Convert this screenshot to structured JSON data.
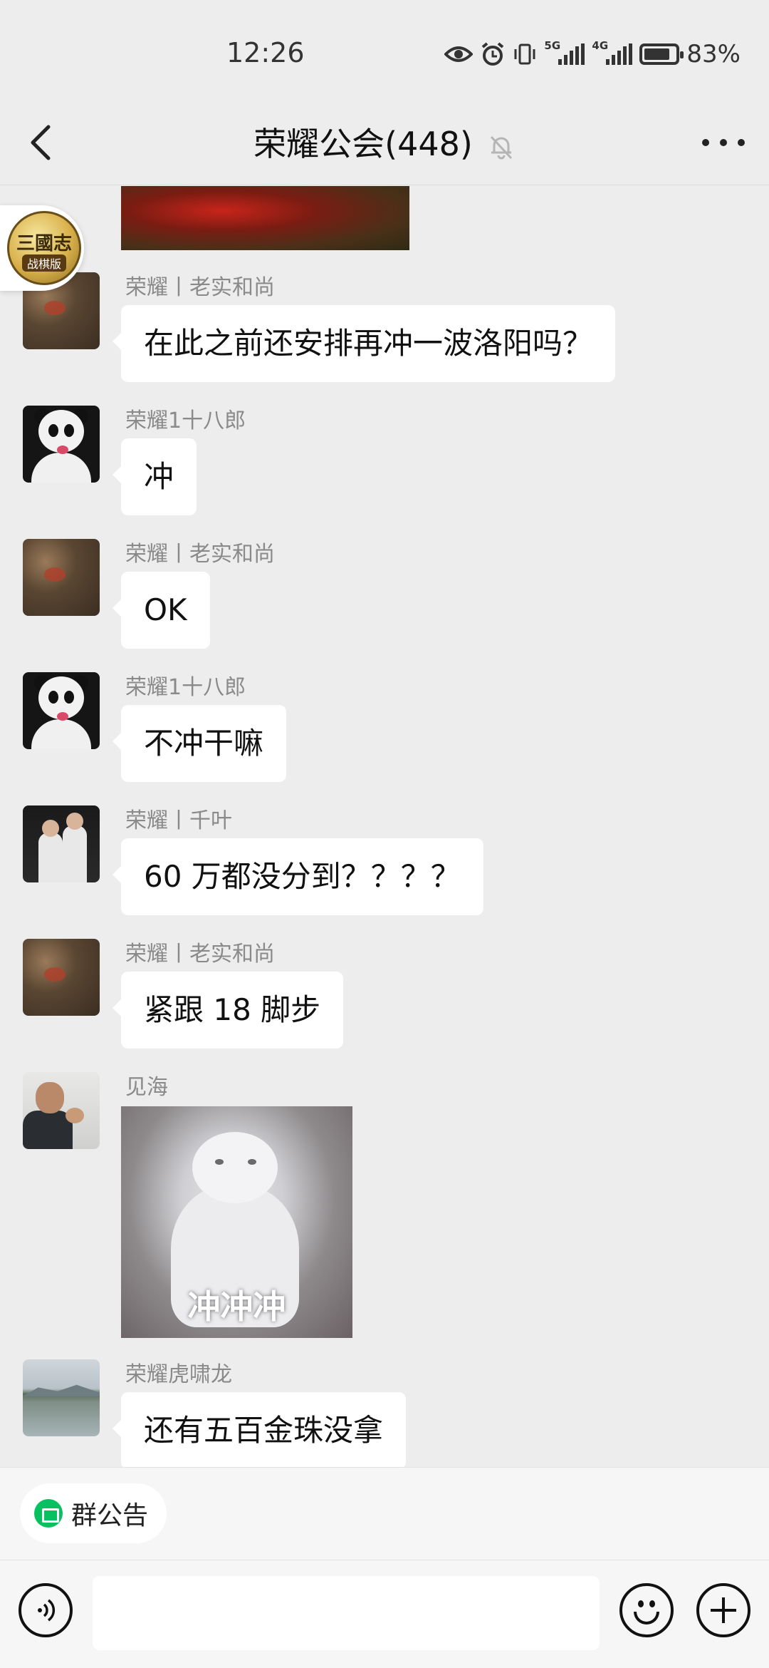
{
  "status_bar": {
    "time": "12:26",
    "signal1_label": "5G",
    "signal2_label": "4G",
    "battery_percent": "83%",
    "battery_level": 0.83,
    "icons": [
      "eye-icon",
      "alarm-icon",
      "vibrate-icon",
      "signal-5g-icon",
      "signal-4g-icon",
      "battery-icon"
    ]
  },
  "header": {
    "title": "荣耀公会(448)",
    "muted": true
  },
  "floating_widget": {
    "line1": "三國志",
    "line2": "战棋版"
  },
  "messages": [
    {
      "sender": "荣耀丨老实和尚",
      "text": "在此之前还安排再冲一波洛阳吗？",
      "avatar": "monk"
    },
    {
      "sender": "荣耀1十八郎",
      "text": "冲",
      "avatar": "panda"
    },
    {
      "sender": "荣耀丨老实和尚",
      "text": "OK",
      "avatar": "monk"
    },
    {
      "sender": "荣耀1十八郎",
      "text": "不冲干嘛",
      "avatar": "panda"
    },
    {
      "sender": "荣耀丨千叶",
      "text": "60 万都没分到？？？？",
      "avatar": "kids"
    },
    {
      "sender": "荣耀丨老实和尚",
      "text": "紧跟 18 脚步",
      "avatar": "monk"
    },
    {
      "sender": "见海",
      "sticker_caption": "冲冲冲",
      "avatar": "man"
    },
    {
      "sender": "荣耀虎啸龙",
      "text": "还有五百金珠没拿",
      "avatar": "lake"
    }
  ],
  "notice": {
    "label": "群公告"
  },
  "input": {
    "value": "",
    "placeholder": ""
  },
  "colors": {
    "background": "#ededed",
    "bubble": "#ffffff",
    "accent": "#07c160"
  }
}
